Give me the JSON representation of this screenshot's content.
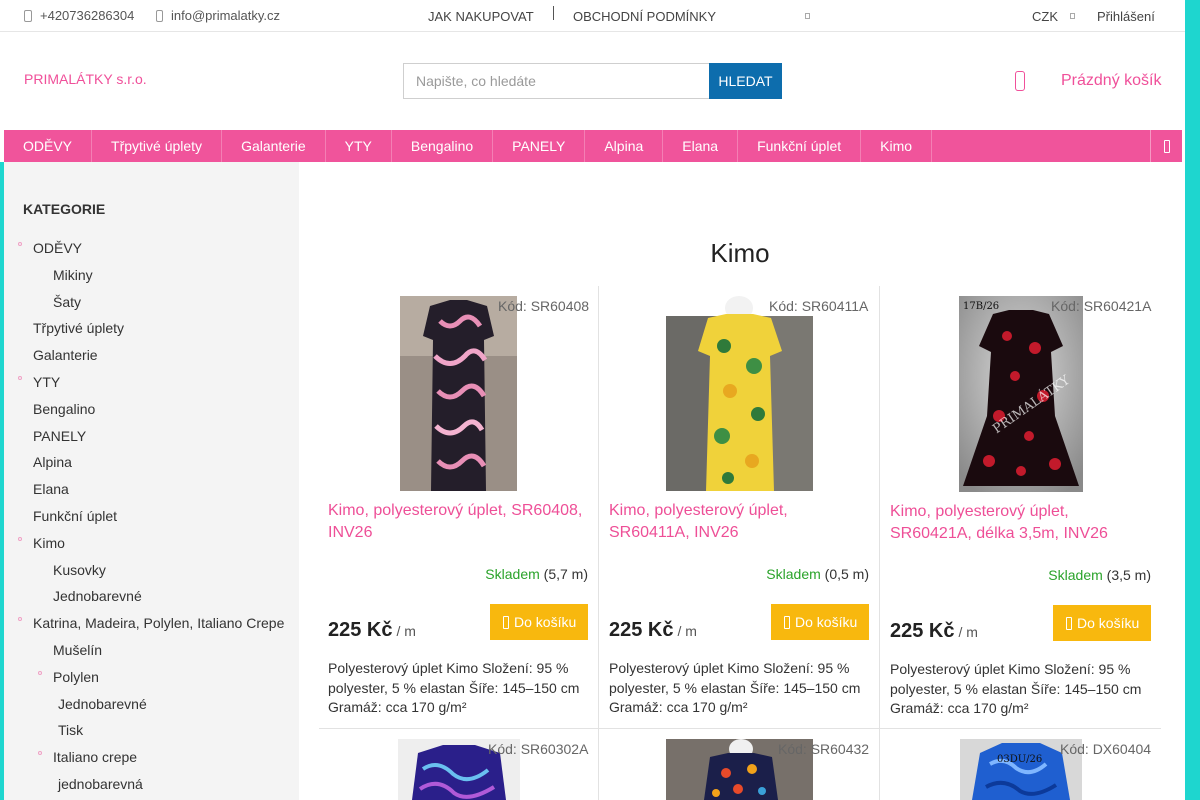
{
  "topbar": {
    "phone": "+420736286304",
    "email": "info@primalatky.cz",
    "how_to_buy": "JAK NAKUPOVAT",
    "terms": "OBCHODNÍ PODMÍNKY",
    "currency": "CZK",
    "login": "Přihlášení"
  },
  "header": {
    "logo": "PRIMALÁTKY s.r.o.",
    "search_placeholder": "Napište, co hledáte",
    "search_button": "HLEDAT",
    "cart_label": "Prázdný košík"
  },
  "nav": [
    "ODĚVY",
    "Třpytivé úplety",
    "Galanterie",
    "YTY",
    "Bengalino",
    "PANELY",
    "Alpina",
    "Elana",
    "Funkční úplet",
    "Kimo"
  ],
  "sidebar": {
    "title": "KATEGORIE",
    "items": [
      {
        "label": "ODĚVY",
        "level": 0,
        "bullet": true
      },
      {
        "label": "Mikiny",
        "level": 1,
        "bullet": false
      },
      {
        "label": "Šaty",
        "level": 1,
        "bullet": false
      },
      {
        "label": "Třpytivé úplety",
        "level": 0,
        "bullet": false
      },
      {
        "label": "Galanterie",
        "level": 0,
        "bullet": false
      },
      {
        "label": "YTY",
        "level": 0,
        "bullet": true
      },
      {
        "label": "Bengalino",
        "level": 0,
        "bullet": false
      },
      {
        "label": "PANELY",
        "level": 0,
        "bullet": false
      },
      {
        "label": "Alpina",
        "level": 0,
        "bullet": false
      },
      {
        "label": "Elana",
        "level": 0,
        "bullet": false
      },
      {
        "label": "Funkční úplet",
        "level": 0,
        "bullet": false
      },
      {
        "label": "Kimo",
        "level": 0,
        "bullet": true
      },
      {
        "label": "Kusovky",
        "level": 1,
        "bullet": false
      },
      {
        "label": "Jednobarevné",
        "level": 1,
        "bullet": false
      },
      {
        "label": "Katrina, Madeira, Polylen, Italiano Crepe",
        "level": 0,
        "bullet": true
      },
      {
        "label": "Mušelín",
        "level": 1,
        "bullet": false
      },
      {
        "label": "Polylen",
        "level": 1,
        "bullet": true
      },
      {
        "label": "Jednobarevné",
        "level": 2,
        "bullet": false
      },
      {
        "label": "Tisk",
        "level": 2,
        "bullet": false
      },
      {
        "label": "Italiano crepe",
        "level": 1,
        "bullet": true
      },
      {
        "label": "jednobarevná",
        "level": 2,
        "bullet": false
      }
    ]
  },
  "page_title": "Kimo",
  "products": [
    {
      "code": "Kód: SR60408",
      "name": "Kimo, polyesterový úplet, SR60408, INV26",
      "stock_label": "Skladem",
      "stock_qty": "(5,7 m)",
      "price": "225 Kč",
      "unit": "/ m",
      "buy_label": "Do košíku",
      "description": "Polyesterový úplet Kimo Složení: 95 % polyester, 5 % elastan Šíře: 145–150 cm Gramáž: cca 170 g/m²",
      "image_overlay": ""
    },
    {
      "code": "Kód: SR60411A",
      "name": "Kimo, polyesterový úplet, SR60411A, INV26",
      "stock_label": "Skladem",
      "stock_qty": "(0,5 m)",
      "price": "225 Kč",
      "unit": "/ m",
      "buy_label": "Do košíku",
      "description": "Polyesterový úplet Kimo Složení: 95 % polyester, 5 % elastan Šíře: 145–150 cm Gramáž: cca 170 g/m²",
      "image_overlay": ""
    },
    {
      "code": "Kód: SR60421A",
      "name": "Kimo, polyesterový úplet, SR60421A, délka 3,5m, INV26",
      "stock_label": "Skladem",
      "stock_qty": "(3,5 m)",
      "price": "225 Kč",
      "unit": "/ m",
      "buy_label": "Do košíku",
      "description": "Polyesterový úplet Kimo Složení: 95 % polyester, 5 % elastan Šíře: 145–150 cm Gramáž: cca 170 g/m²",
      "image_overlay": "17B/26",
      "image_watermark": "PRIMALÁTKY"
    },
    {
      "code": "Kód: SR60302A",
      "image_overlay": ""
    },
    {
      "code": "Kód: SR60432",
      "image_overlay": ""
    },
    {
      "code": "Kód: DX60404",
      "image_overlay": "03DU/26"
    }
  ]
}
